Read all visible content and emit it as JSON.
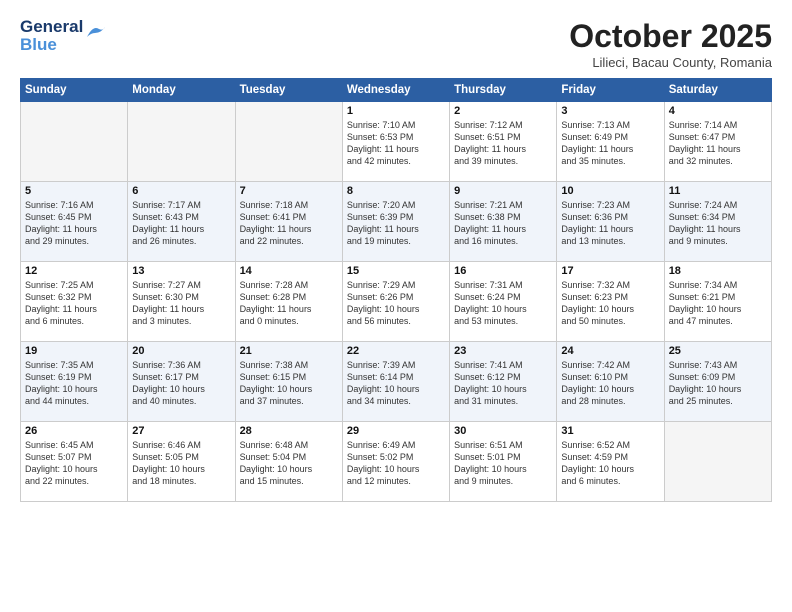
{
  "logo": {
    "line1": "General",
    "line2": "Blue"
  },
  "title": "October 2025",
  "subtitle": "Lilieci, Bacau County, Romania",
  "weekdays": [
    "Sunday",
    "Monday",
    "Tuesday",
    "Wednesday",
    "Thursday",
    "Friday",
    "Saturday"
  ],
  "weeks": [
    [
      {
        "day": "",
        "info": ""
      },
      {
        "day": "",
        "info": ""
      },
      {
        "day": "",
        "info": ""
      },
      {
        "day": "1",
        "info": "Sunrise: 7:10 AM\nSunset: 6:53 PM\nDaylight: 11 hours\nand 42 minutes."
      },
      {
        "day": "2",
        "info": "Sunrise: 7:12 AM\nSunset: 6:51 PM\nDaylight: 11 hours\nand 39 minutes."
      },
      {
        "day": "3",
        "info": "Sunrise: 7:13 AM\nSunset: 6:49 PM\nDaylight: 11 hours\nand 35 minutes."
      },
      {
        "day": "4",
        "info": "Sunrise: 7:14 AM\nSunset: 6:47 PM\nDaylight: 11 hours\nand 32 minutes."
      }
    ],
    [
      {
        "day": "5",
        "info": "Sunrise: 7:16 AM\nSunset: 6:45 PM\nDaylight: 11 hours\nand 29 minutes."
      },
      {
        "day": "6",
        "info": "Sunrise: 7:17 AM\nSunset: 6:43 PM\nDaylight: 11 hours\nand 26 minutes."
      },
      {
        "day": "7",
        "info": "Sunrise: 7:18 AM\nSunset: 6:41 PM\nDaylight: 11 hours\nand 22 minutes."
      },
      {
        "day": "8",
        "info": "Sunrise: 7:20 AM\nSunset: 6:39 PM\nDaylight: 11 hours\nand 19 minutes."
      },
      {
        "day": "9",
        "info": "Sunrise: 7:21 AM\nSunset: 6:38 PM\nDaylight: 11 hours\nand 16 minutes."
      },
      {
        "day": "10",
        "info": "Sunrise: 7:23 AM\nSunset: 6:36 PM\nDaylight: 11 hours\nand 13 minutes."
      },
      {
        "day": "11",
        "info": "Sunrise: 7:24 AM\nSunset: 6:34 PM\nDaylight: 11 hours\nand 9 minutes."
      }
    ],
    [
      {
        "day": "12",
        "info": "Sunrise: 7:25 AM\nSunset: 6:32 PM\nDaylight: 11 hours\nand 6 minutes."
      },
      {
        "day": "13",
        "info": "Sunrise: 7:27 AM\nSunset: 6:30 PM\nDaylight: 11 hours\nand 3 minutes."
      },
      {
        "day": "14",
        "info": "Sunrise: 7:28 AM\nSunset: 6:28 PM\nDaylight: 11 hours\nand 0 minutes."
      },
      {
        "day": "15",
        "info": "Sunrise: 7:29 AM\nSunset: 6:26 PM\nDaylight: 10 hours\nand 56 minutes."
      },
      {
        "day": "16",
        "info": "Sunrise: 7:31 AM\nSunset: 6:24 PM\nDaylight: 10 hours\nand 53 minutes."
      },
      {
        "day": "17",
        "info": "Sunrise: 7:32 AM\nSunset: 6:23 PM\nDaylight: 10 hours\nand 50 minutes."
      },
      {
        "day": "18",
        "info": "Sunrise: 7:34 AM\nSunset: 6:21 PM\nDaylight: 10 hours\nand 47 minutes."
      }
    ],
    [
      {
        "day": "19",
        "info": "Sunrise: 7:35 AM\nSunset: 6:19 PM\nDaylight: 10 hours\nand 44 minutes."
      },
      {
        "day": "20",
        "info": "Sunrise: 7:36 AM\nSunset: 6:17 PM\nDaylight: 10 hours\nand 40 minutes."
      },
      {
        "day": "21",
        "info": "Sunrise: 7:38 AM\nSunset: 6:15 PM\nDaylight: 10 hours\nand 37 minutes."
      },
      {
        "day": "22",
        "info": "Sunrise: 7:39 AM\nSunset: 6:14 PM\nDaylight: 10 hours\nand 34 minutes."
      },
      {
        "day": "23",
        "info": "Sunrise: 7:41 AM\nSunset: 6:12 PM\nDaylight: 10 hours\nand 31 minutes."
      },
      {
        "day": "24",
        "info": "Sunrise: 7:42 AM\nSunset: 6:10 PM\nDaylight: 10 hours\nand 28 minutes."
      },
      {
        "day": "25",
        "info": "Sunrise: 7:43 AM\nSunset: 6:09 PM\nDaylight: 10 hours\nand 25 minutes."
      }
    ],
    [
      {
        "day": "26",
        "info": "Sunrise: 6:45 AM\nSunset: 5:07 PM\nDaylight: 10 hours\nand 22 minutes."
      },
      {
        "day": "27",
        "info": "Sunrise: 6:46 AM\nSunset: 5:05 PM\nDaylight: 10 hours\nand 18 minutes."
      },
      {
        "day": "28",
        "info": "Sunrise: 6:48 AM\nSunset: 5:04 PM\nDaylight: 10 hours\nand 15 minutes."
      },
      {
        "day": "29",
        "info": "Sunrise: 6:49 AM\nSunset: 5:02 PM\nDaylight: 10 hours\nand 12 minutes."
      },
      {
        "day": "30",
        "info": "Sunrise: 6:51 AM\nSunset: 5:01 PM\nDaylight: 10 hours\nand 9 minutes."
      },
      {
        "day": "31",
        "info": "Sunrise: 6:52 AM\nSunset: 4:59 PM\nDaylight: 10 hours\nand 6 minutes."
      },
      {
        "day": "",
        "info": ""
      }
    ]
  ]
}
